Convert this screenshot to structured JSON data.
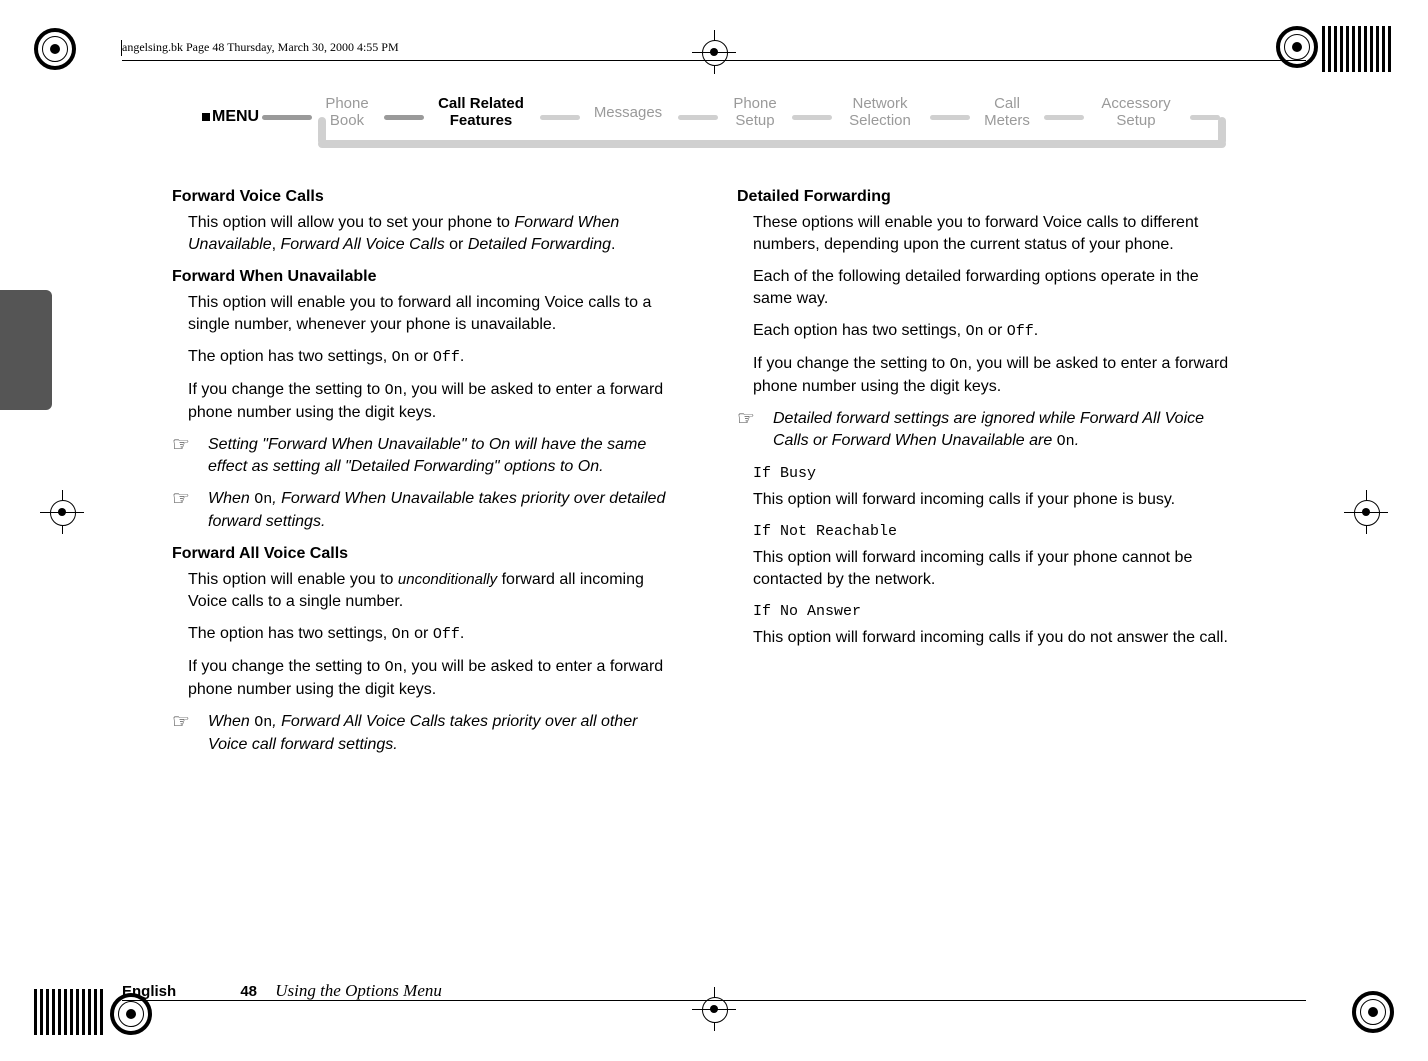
{
  "header_line": "angelsing.bk  Page 48  Thursday, March 30, 2000  4:55 PM",
  "menu_label": "MENU",
  "nav": [
    {
      "l1": "Phone",
      "l2": "Book"
    },
    {
      "l1": "Call Related",
      "l2": "Features"
    },
    {
      "l1": "Messages",
      "l2": ""
    },
    {
      "l1": "Phone",
      "l2": "Setup"
    },
    {
      "l1": "Network",
      "l2": "Selection"
    },
    {
      "l1": "Call",
      "l2": "Meters"
    },
    {
      "l1": "Accessory",
      "l2": "Setup"
    }
  ],
  "left": {
    "h1": "Forward Voice Calls",
    "p1a": "This option will allow you to set your phone to ",
    "p1b": "Forward When Unavailable",
    "p1c": ", ",
    "p1d": "Forward All Voice Calls",
    "p1e": " or ",
    "p1f": "Detailed Forwarding",
    "p1g": ".",
    "h2": "Forward When Unavailable",
    "p2": "This option will enable you to forward all incoming Voice calls to a single number, whenever your phone is unavailable.",
    "p3a": "The option has two settings, ",
    "p3b": "On",
    "p3c": " or ",
    "p3d": "Off",
    "p3e": ".",
    "p4a": "If you change the setting to ",
    "p4b": "On",
    "p4c": ", you will be asked to enter a forward phone number using the digit keys.",
    "n1": "Setting \"Forward When Unavailable\" to On will have the same effect as setting all \"Detailed Forwarding\" options to On.",
    "n2a": "When ",
    "n2b": "On",
    "n2c": ", Forward When Unavailable takes priority over detailed forward settings.",
    "h3": "Forward All Voice Calls",
    "p5a": "This option will enable you to ",
    "p5b": "unconditionally",
    "p5c": " forward all incoming Voice calls to a single number.",
    "p6a": "The option has two settings, ",
    "p6b": "On",
    "p6c": " or ",
    "p6d": "Off",
    "p6e": ".",
    "p7a": "If you change the setting to ",
    "p7b": "On",
    "p7c": ", you will be asked to enter a forward phone number using the digit keys.",
    "n3a": "When ",
    "n3b": "On",
    "n3c": ", Forward All Voice Calls takes priority over all other Voice call forward settings."
  },
  "right": {
    "h1": "Detailed Forwarding",
    "p1": "These options will enable you to forward Voice calls to different numbers, depending upon the current status of your phone.",
    "p2": "Each of the following detailed forwarding options operate in the same way.",
    "p3a": "Each option has two settings, ",
    "p3b": "On",
    "p3c": " or ",
    "p3d": "Off",
    "p3e": ".",
    "p4a": "If you change the setting to ",
    "p4b": "On",
    "p4c": ", you will be asked to enter a forward phone number using the digit keys.",
    "n1a": "Detailed forward settings are ignored while Forward All Voice Calls or Forward When Unavailable are ",
    "n1b": "On",
    "n1c": ".",
    "s1": "If Busy",
    "p5": "This option will forward incoming calls if your phone is busy.",
    "s2": "If Not Reachable",
    "p6": "This option will forward incoming calls if your phone cannot be contacted by the network.",
    "s3": "If No Answer",
    "p7": "This option will forward incoming calls if you do not answer the call."
  },
  "footer": {
    "eng": "English",
    "pg": "48",
    "sec": "Using the Options Menu"
  },
  "hand": "☞"
}
